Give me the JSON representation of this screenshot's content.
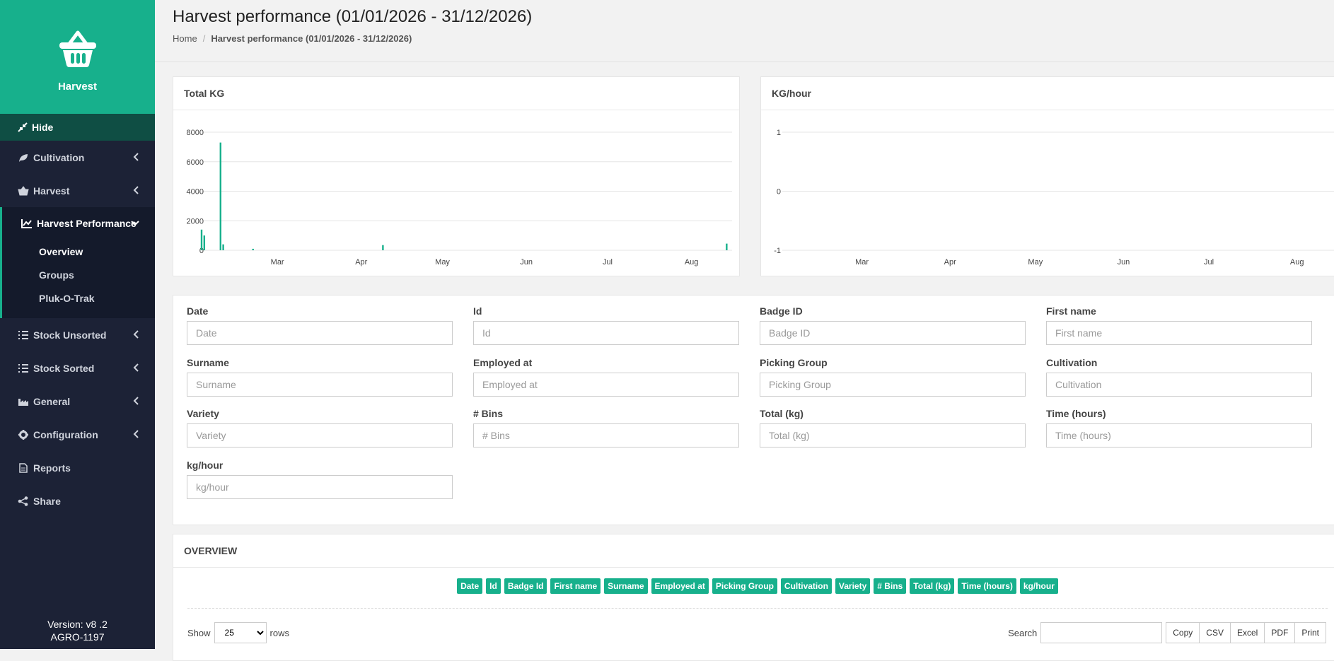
{
  "sidebar": {
    "brand": "Harvest",
    "hide_label": "Hide",
    "items": [
      {
        "label": "Cultivation"
      },
      {
        "label": "Harvest"
      },
      {
        "label": "Harvest Performance"
      },
      {
        "label": "Stock Unsorted"
      },
      {
        "label": "Stock Sorted"
      },
      {
        "label": "General"
      },
      {
        "label": "Configuration"
      },
      {
        "label": "Reports"
      },
      {
        "label": "Share"
      }
    ],
    "subitems": [
      "Overview",
      "Groups",
      "Pluk-O-Trak"
    ],
    "version_line1": "Version: v8 .2",
    "version_line2": "AGRO-1197"
  },
  "header": {
    "title": "Harvest performance (01/01/2026 - 31/12/2026)",
    "breadcrumb_home": "Home",
    "breadcrumb_current": "Harvest performance (01/01/2026 - 31/12/2026)"
  },
  "chart_titles": [
    "Total KG",
    "KG/hour"
  ],
  "chart_data": [
    {
      "type": "bar",
      "title": "Total KG",
      "ylim": [
        0,
        8000
      ],
      "yticks": [
        0,
        2000,
        4000,
        6000,
        8000
      ],
      "xticks": [
        "Mar",
        "Apr",
        "May",
        "Jun",
        "Jul",
        "Aug"
      ],
      "bars": [
        {
          "date": "Feb 1",
          "value": 1400
        },
        {
          "date": "Feb 2",
          "value": 1000
        },
        {
          "date": "Feb 8",
          "value": 7300
        },
        {
          "date": "Feb 9",
          "value": 400
        },
        {
          "date": "Feb 20",
          "value": 100
        },
        {
          "date": "Apr 9",
          "value": 350
        },
        {
          "date": "Aug 14",
          "value": 450
        }
      ],
      "color": "#17b08c",
      "grid": true
    },
    {
      "type": "line",
      "title": "KG/hour",
      "ylim": [
        -1,
        1
      ],
      "yticks": [
        -1,
        0,
        1
      ],
      "xticks": [
        "Mar",
        "Apr",
        "May",
        "Jun",
        "Jul",
        "Aug"
      ],
      "series": [],
      "grid": true
    }
  ],
  "filters": [
    {
      "label": "Date",
      "placeholder": "Date"
    },
    {
      "label": "Id",
      "placeholder": "Id"
    },
    {
      "label": "Badge ID",
      "placeholder": "Badge ID"
    },
    {
      "label": "First name",
      "placeholder": "First name"
    },
    {
      "label": "Surname",
      "placeholder": "Surname"
    },
    {
      "label": "Employed at",
      "placeholder": "Employed at"
    },
    {
      "label": "Picking Group",
      "placeholder": "Picking Group"
    },
    {
      "label": "Cultivation",
      "placeholder": "Cultivation"
    },
    {
      "label": "Variety",
      "placeholder": "Variety"
    },
    {
      "label": "# Bins",
      "placeholder": "# Bins"
    },
    {
      "label": "Total (kg)",
      "placeholder": "Total (kg)"
    },
    {
      "label": "Time (hours)",
      "placeholder": "Time (hours)"
    },
    {
      "label": "kg/hour",
      "placeholder": "kg/hour"
    }
  ],
  "overview": {
    "title": "OVERVIEW",
    "columns": [
      "Date",
      "Id",
      "Badge Id",
      "First name",
      "Surname",
      "Employed at",
      "Picking Group",
      "Cultivation",
      "Variety",
      "# Bins",
      "Total (kg)",
      "Time (hours)",
      "kg/hour"
    ],
    "show_label": "Show",
    "rows_label": "rows",
    "page_size": "25",
    "search_label": "Search",
    "buttons": [
      "Copy",
      "CSV",
      "Excel",
      "PDF",
      "Print"
    ]
  },
  "colors": {
    "accent": "#17b08c",
    "sidebar": "#1c2236"
  }
}
